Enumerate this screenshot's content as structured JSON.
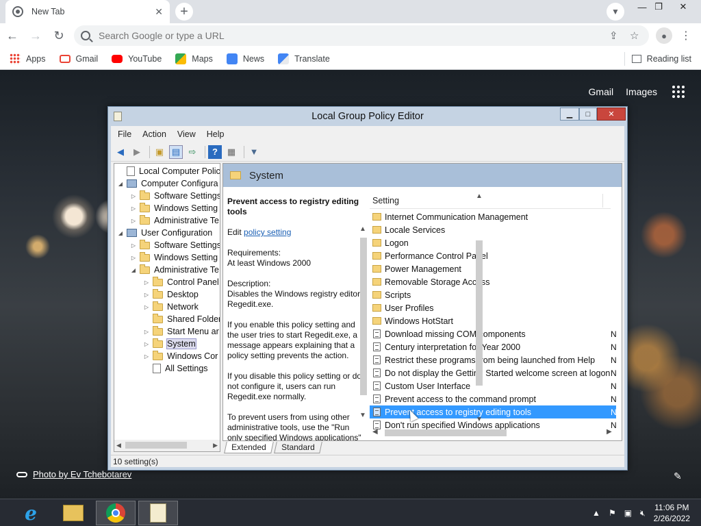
{
  "browser": {
    "tab_title": "New Tab",
    "tab_close": "✕",
    "new_tab": "+",
    "omnibox_placeholder": "Search Google or type a URL",
    "bookmarks": [
      {
        "label": "Apps",
        "icon": "apps-icon"
      },
      {
        "label": "Gmail",
        "icon": "gmail-icon",
        "color": "#ea4335"
      },
      {
        "label": "YouTube",
        "icon": "youtube-icon",
        "color": "#ff0000"
      },
      {
        "label": "Maps",
        "icon": "maps-icon",
        "color": "#34a853"
      },
      {
        "label": "News",
        "icon": "news-icon",
        "color": "#4285f4"
      },
      {
        "label": "Translate",
        "icon": "translate-icon",
        "color": "#4285f4"
      }
    ],
    "reading_list": "Reading list"
  },
  "ntp": {
    "gmail": "Gmail",
    "images": "Images",
    "photo_credit": "Photo by Ev Tchebotarev"
  },
  "gpe": {
    "title": "Local Group Policy Editor",
    "menu": [
      "File",
      "Action",
      "View",
      "Help"
    ],
    "tree": [
      {
        "label": "Local Computer Policy",
        "icon": "doc",
        "exp": "",
        "level": 0
      },
      {
        "label": "Computer Configura",
        "icon": "pc",
        "exp": "◢",
        "level": 0
      },
      {
        "label": "Software Settings",
        "icon": "folder",
        "exp": "▷",
        "level": 1
      },
      {
        "label": "Windows Setting",
        "icon": "folder",
        "exp": "▷",
        "level": 1
      },
      {
        "label": "Administrative Te",
        "icon": "folder",
        "exp": "▷",
        "level": 1
      },
      {
        "label": "User Configuration",
        "icon": "pc",
        "exp": "◢",
        "level": 0
      },
      {
        "label": "Software Settings",
        "icon": "folder",
        "exp": "▷",
        "level": 1
      },
      {
        "label": "Windows Setting",
        "icon": "folder",
        "exp": "▷",
        "level": 1
      },
      {
        "label": "Administrative Te",
        "icon": "folder",
        "exp": "◢",
        "level": 1
      },
      {
        "label": "Control Panel",
        "icon": "folder",
        "exp": "▷",
        "level": 2
      },
      {
        "label": "Desktop",
        "icon": "folder",
        "exp": "▷",
        "level": 2
      },
      {
        "label": "Network",
        "icon": "folder",
        "exp": "▷",
        "level": 2
      },
      {
        "label": "Shared Folder",
        "icon": "folder",
        "exp": "",
        "level": 2
      },
      {
        "label": "Start Menu ar",
        "icon": "folder",
        "exp": "▷",
        "level": 2
      },
      {
        "label": "System",
        "icon": "folder",
        "exp": "▷",
        "level": 2,
        "selected": true
      },
      {
        "label": "Windows Cor",
        "icon": "folder",
        "exp": "▷",
        "level": 2
      },
      {
        "label": "All Settings",
        "icon": "doc",
        "exp": "",
        "level": 2
      }
    ],
    "pane_header": "System",
    "desc": {
      "title": "Prevent access to registry editing tools",
      "edit_prefix": "Edit ",
      "edit_link": "policy setting ",
      "requirements_label": "Requirements:",
      "requirements": "At least Windows 2000",
      "description_label": "Description:",
      "description": "Disables the Windows registry editor Regedit.exe.",
      "p1": "If you enable this policy setting and the user tries to start Regedit.exe, a message appears explaining that a policy setting prevents the action.",
      "p2": "If you disable this policy setting or do not configure it, users can run Regedit.exe normally.",
      "p3": "To prevent users from using other administrative tools, use the \"Run only specified Windows applications\" policy setting."
    },
    "list_header": "Setting",
    "rows": [
      {
        "label": "Internet Communication Management",
        "type": "folder",
        "state": ""
      },
      {
        "label": "Locale Services",
        "type": "folder",
        "state": ""
      },
      {
        "label": "Logon",
        "type": "folder",
        "state": ""
      },
      {
        "label": "Performance Control Panel",
        "type": "folder",
        "state": ""
      },
      {
        "label": "Power Management",
        "type": "folder",
        "state": ""
      },
      {
        "label": "Removable Storage Access",
        "type": "folder",
        "state": ""
      },
      {
        "label": "Scripts",
        "type": "folder",
        "state": ""
      },
      {
        "label": "User Profiles",
        "type": "folder",
        "state": ""
      },
      {
        "label": "Windows HotStart",
        "type": "folder",
        "state": ""
      },
      {
        "label": "Download missing COM components",
        "type": "policy",
        "state": "N"
      },
      {
        "label": "Century interpretation for Year 2000",
        "type": "policy",
        "state": "N"
      },
      {
        "label": "Restrict these programs from being launched from Help",
        "type": "policy",
        "state": "N"
      },
      {
        "label": "Do not display the Getting Started welcome screen at logon",
        "type": "policy",
        "state": "N"
      },
      {
        "label": "Custom User Interface",
        "type": "policy",
        "state": "N"
      },
      {
        "label": "Prevent access to the command prompt",
        "type": "policy",
        "state": "N"
      },
      {
        "label": "Prevent access to registry editing tools",
        "type": "policy",
        "state": "N",
        "selected": true
      },
      {
        "label": "Don't run specified Windows applications",
        "type": "policy",
        "state": "N"
      }
    ],
    "tabs": [
      "Extended",
      "Standard"
    ],
    "status": "10 setting(s)"
  },
  "taskbar": {
    "time": "11:06 PM",
    "date": "2/26/2022"
  }
}
